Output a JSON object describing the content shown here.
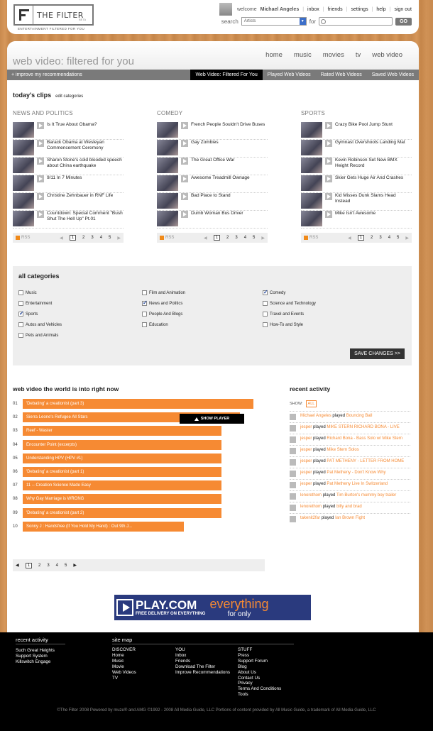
{
  "header": {
    "logo_word": "THE FILTER",
    "beta": "BETA",
    "tagline": "ENTERTAINMENT FILTERED FOR YOU",
    "welcome": "welcome",
    "username": "Michael Angeles",
    "nav": [
      "inbox",
      "friends",
      "settings",
      "help",
      "sign out"
    ],
    "search_label": "search",
    "search_scope": "Artists",
    "for_label": "for",
    "search_value": "",
    "go": "GO"
  },
  "page": {
    "title": "web video: filtered for you",
    "topnav": [
      "home",
      "music",
      "movies",
      "tv",
      "web video"
    ],
    "improve": "+ improve my recommendations",
    "tabs": [
      "Web Video: Filtered For You",
      "Played Web Videos",
      "Rated Web Videos",
      "Saved Web Videos"
    ]
  },
  "clips": {
    "heading": "today's clips",
    "edit": "edit categories",
    "categories": [
      {
        "name": "NEWS AND POLITICS",
        "items": [
          "Is It True About Obama?",
          "Barack Obama at Wesleyan Commencement Ceremony",
          "Sharon Stone's cold blooded speech about China earthquake",
          "9/11 In 7 Minutes",
          "Christine Zehnbauer in RNF Life",
          "Countdown: Special Comment \"Bush Shut The Hell Up\" Pt.01"
        ]
      },
      {
        "name": "COMEDY",
        "items": [
          "French People Souldn't Drive Buses",
          "Gay Zombies",
          "The Great Office War",
          "Awesome Treadmill Ownage",
          "Bad Place to Stand",
          "Dumb Woman Bus Driver"
        ]
      },
      {
        "name": "SPORTS",
        "items": [
          "Crazy Bike Pool Jump Stunt",
          "Gymnast Overshoots Landing Mat",
          "Kevin Robinson Set New BMX Height Record",
          "Skier Gets Huge Air And Crashes",
          "Kid Misses Dunk Slams Head Instead",
          "Mike Isn't Awesome"
        ]
      }
    ],
    "rss": "RSS",
    "pages": [
      "1",
      "2",
      "3",
      "4",
      "5"
    ]
  },
  "allcats": {
    "heading": "all categories",
    "save": "SAVE CHANGES >>",
    "items": [
      {
        "label": "Music",
        "checked": false
      },
      {
        "label": "Entertainment",
        "checked": false
      },
      {
        "label": "Sports",
        "checked": true
      },
      {
        "label": "Autos and Vehicles",
        "checked": false
      },
      {
        "label": "Pets and Animals",
        "checked": false
      },
      {
        "label": "Film and Animation",
        "checked": false
      },
      {
        "label": "News and Politics",
        "checked": true
      },
      {
        "label": "People And Blogs",
        "checked": false
      },
      {
        "label": "Education",
        "checked": false
      },
      {
        "label": "Comedy",
        "checked": true
      },
      {
        "label": "Science and Technology",
        "checked": false
      },
      {
        "label": "Travel and Events",
        "checked": false
      },
      {
        "label": "How-To and Style",
        "checked": false
      }
    ]
  },
  "world": {
    "heading": "web video the world is into right now",
    "show_player": "SHOW PLAYER",
    "rows": [
      {
        "num": "01",
        "title": "'Debating' a creationist (part 3)",
        "score": 1.0
      },
      {
        "num": "02",
        "title": "Sierra Leone's Refugee All Stars",
        "score": 0.94
      },
      {
        "num": "03",
        "title": "Reef - Waster",
        "score": 0.86
      },
      {
        "num": "04",
        "title": "Encounter Point (excerpts)",
        "score": 0.86
      },
      {
        "num": "05",
        "title": "Understanding HPV (HPV #1)",
        "score": 0.86
      },
      {
        "num": "06",
        "title": "'Debating' a creationist (part 1)",
        "score": 0.86
      },
      {
        "num": "07",
        "title": "11 -- Creation Science Made Easy",
        "score": 0.86
      },
      {
        "num": "08",
        "title": "Why Gay Marriage is WRONG",
        "score": 0.86
      },
      {
        "num": "09",
        "title": "'Debating' a creationist (part 2)",
        "score": 0.86
      },
      {
        "num": "10",
        "title": "Sonny J : Handsfree (If You Hold My Hand) : Out 9th J...",
        "score": 0.7
      }
    ],
    "pages": [
      "1",
      "2",
      "3",
      "4",
      "5"
    ]
  },
  "recent": {
    "heading": "recent activity",
    "show": "SHOW:",
    "all": "ALL",
    "items": [
      {
        "user": "Michael Angeles",
        "verb": "played",
        "item": "Bouncing Ball"
      },
      {
        "user": "jesper",
        "verb": "played",
        "item": "MIKE STERN RICHARD BONA - LIVE"
      },
      {
        "user": "jesper",
        "verb": "played",
        "item": "Richard Bona - Bass Solo w/ Mike Stern"
      },
      {
        "user": "jesper",
        "verb": "played",
        "item": "Mike Stern Solos"
      },
      {
        "user": "jesper",
        "verb": "played",
        "item": "PAT METHENY - LETTER FROM HOME"
      },
      {
        "user": "jesper",
        "verb": "played",
        "item": "Pat Metheny - Don't Know Why"
      },
      {
        "user": "jesper",
        "verb": "played",
        "item": "Pat Metheny Live In Switzerland"
      },
      {
        "user": "lenorethom",
        "verb": "played",
        "item": "Tim Burton's mummy boy trailer"
      },
      {
        "user": "lenorethom",
        "verb": "played",
        "item": "billy and brad"
      },
      {
        "user": "takenit2far",
        "verb": "played",
        "item": "Ian Brown Fight"
      }
    ]
  },
  "ad": {
    "brand": "PLAY.COM",
    "line": "FREE DELIVERY ON EVERYTHING",
    "everything": "everything",
    "for_only": "for only"
  },
  "footer": {
    "recent_title": "recent activity",
    "recent": [
      "Such Great Heights",
      "Support System",
      "Killswitch Engage"
    ],
    "sitemap_title": "site map",
    "discover": [
      "DISCOVER",
      "Home",
      "Music",
      "Movie",
      "Web Videos",
      "TV"
    ],
    "you": [
      "YOU",
      "Inbox",
      "Friends",
      "Download The Filter",
      "Improve Recommendations"
    ],
    "stuff": [
      "STUFF",
      "Press",
      "Support Forum",
      "Blog",
      "About Us",
      "Contact Us",
      "Privacy",
      "Terms And Conditions",
      "Tools"
    ],
    "copyright": "©The Filter 2008 Powered by muze® and AMG ©1992 - 2008 All Media Guide, LLC Portions of content provided by All Music Guide, a trademark of All Media Guide, LLC"
  }
}
